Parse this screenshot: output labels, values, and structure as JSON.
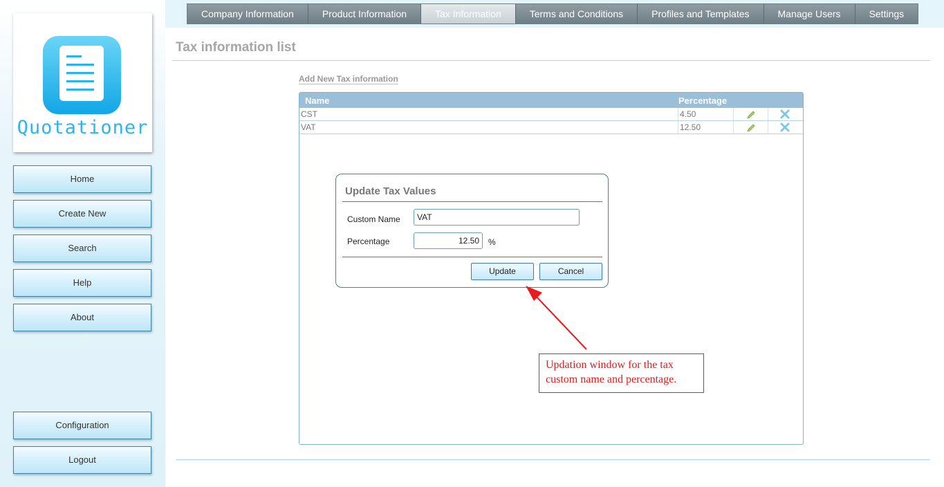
{
  "app": {
    "logo_text": "Quotationer"
  },
  "sidebar": {
    "items": [
      {
        "label": "Home"
      },
      {
        "label": "Create New"
      },
      {
        "label": "Search"
      },
      {
        "label": "Help"
      },
      {
        "label": "About"
      }
    ],
    "bottom_items": [
      {
        "label": "Configuration"
      },
      {
        "label": "Logout"
      }
    ]
  },
  "tabs": [
    {
      "label": "Company Information",
      "active": false
    },
    {
      "label": "Product Information",
      "active": false
    },
    {
      "label": "Tax Information",
      "active": true
    },
    {
      "label": "Terms and Conditions",
      "active": false
    },
    {
      "label": "Profiles and Templates",
      "active": false
    },
    {
      "label": "Manage Users",
      "active": false
    },
    {
      "label": "Settings",
      "active": false
    }
  ],
  "page": {
    "title": "Tax information list",
    "add_link": "Add New Tax information"
  },
  "grid": {
    "columns": {
      "name": "Name",
      "percentage": "Percentage"
    },
    "rows": [
      {
        "name": "CST",
        "percentage": "4.50"
      },
      {
        "name": "VAT",
        "percentage": "12.50"
      }
    ]
  },
  "dialog": {
    "title": "Update Tax Values",
    "custom_name_label": "Custom Name",
    "custom_name_value": "VAT",
    "percentage_label": "Percentage",
    "percentage_value": "12.50",
    "percent_sign": "%",
    "update_label": "Update",
    "cancel_label": "Cancel"
  },
  "annotation": {
    "text": "Updation window for the tax custom name and percentage.",
    "color": "#dd1c1c"
  },
  "colors": {
    "accent": "#3a85a6",
    "grid_header": "#9bbfd8",
    "tab_bg": "#7f8e95"
  },
  "icons": {
    "edit": "pencil-icon",
    "delete": "close-icon"
  }
}
